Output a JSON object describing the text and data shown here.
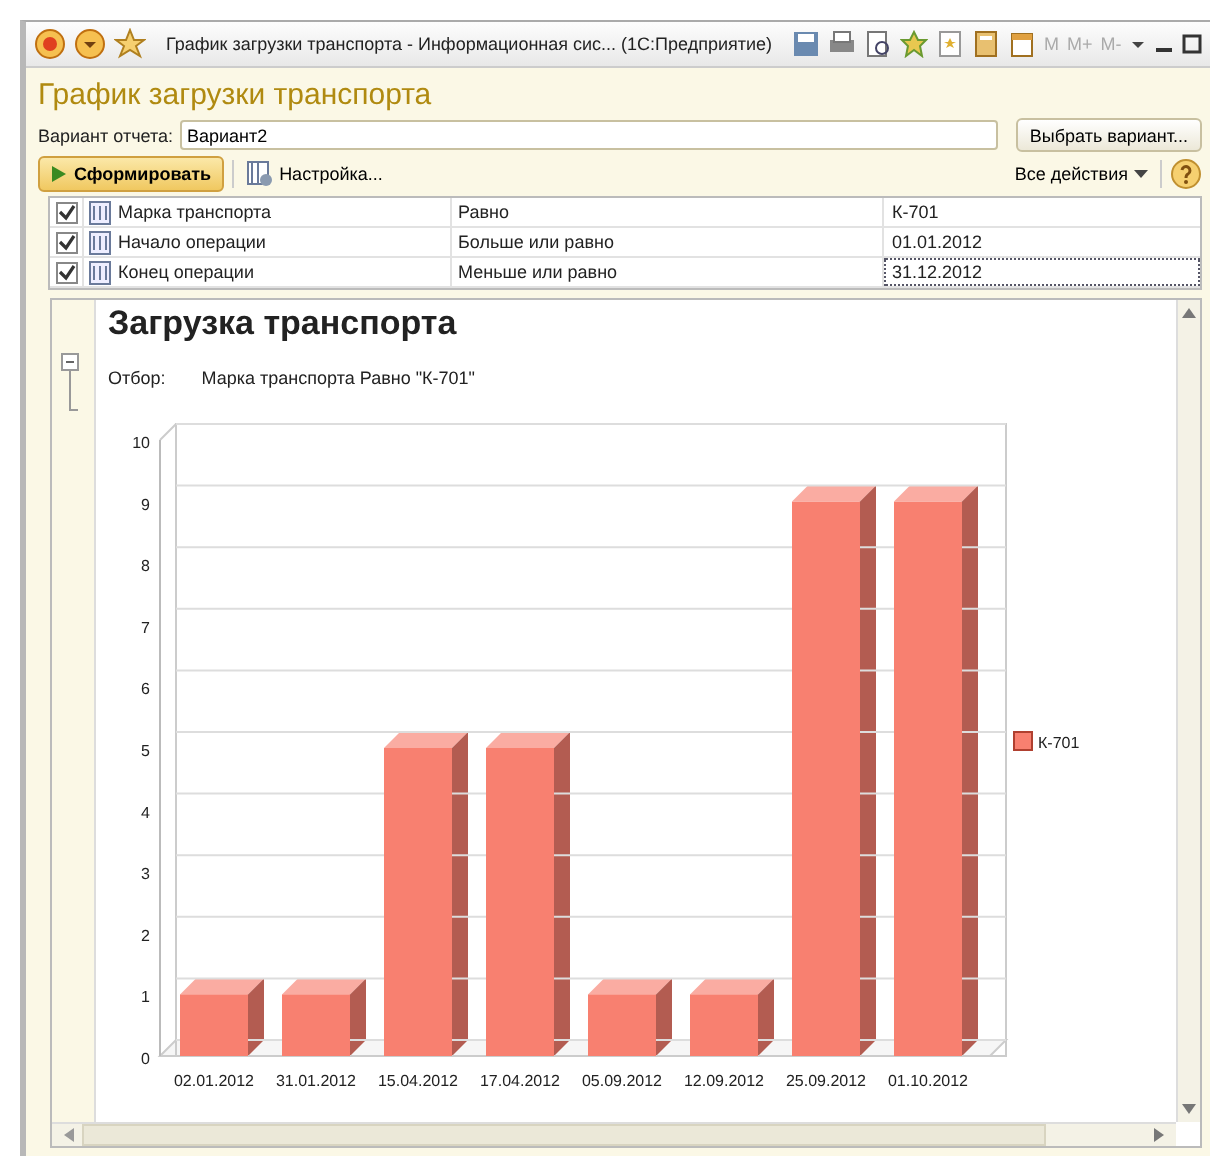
{
  "window": {
    "title": "График загрузки транспорта - Информационная сис... (1С:Предприятие)",
    "memory_keys": [
      "M",
      "M+",
      "M-"
    ]
  },
  "form": {
    "title": "График загрузки транспорта",
    "variant_label": "Вариант отчета:",
    "variant_value": "Вариант2",
    "choose_button": "Выбрать вариант..."
  },
  "toolbar": {
    "generate": "Сформировать",
    "settings": "Настройка...",
    "all_actions": "Все действия"
  },
  "filters": [
    {
      "checked": true,
      "field": "Марка транспорта",
      "condition": "Равно",
      "value": "К-701",
      "selected": false
    },
    {
      "checked": true,
      "field": "Начало операции",
      "condition": "Больше или равно",
      "value": "01.01.2012",
      "selected": false
    },
    {
      "checked": true,
      "field": "Конец операции",
      "condition": "Меньше или равно",
      "value": "31.12.2012",
      "selected": true
    }
  ],
  "report": {
    "title": "Загрузка транспорта",
    "filter_label": "Отбор:",
    "filter_text": "Марка транспорта Равно \"К-701\"",
    "chart_data": {
      "type": "bar",
      "categories": [
        "02.01.2012",
        "31.01.2012",
        "15.04.2012",
        "17.04.2012",
        "05.09.2012",
        "12.09.2012",
        "25.09.2012",
        "01.10.2012"
      ],
      "series": [
        {
          "name": "К-701",
          "color": "#f88070",
          "values": [
            1,
            1,
            5,
            5,
            1,
            1,
            9,
            9
          ]
        }
      ],
      "ylim": [
        0,
        10
      ],
      "yticks": [
        0,
        1,
        2,
        3,
        4,
        5,
        6,
        7,
        8,
        9,
        10
      ]
    }
  }
}
